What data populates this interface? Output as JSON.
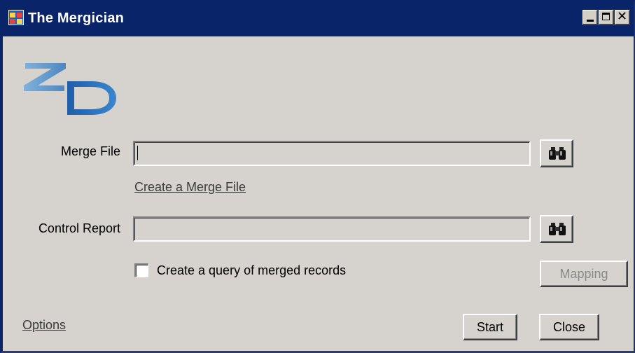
{
  "window": {
    "title": "The Mergician",
    "icon": "app-window-icon",
    "caption_buttons": [
      "minimize-icon",
      "maximize-icon",
      "close-icon"
    ]
  },
  "logo": {
    "icon": "zd-logo"
  },
  "merge_file": {
    "label": "Merge File",
    "value": "",
    "browse_icon": "binoculars-icon"
  },
  "create_merge_link": "Create a Merge File",
  "control_report": {
    "label": "Control Report",
    "value": "",
    "browse_icon": "binoculars-icon"
  },
  "query_checkbox": {
    "label": "Create a query of merged records",
    "checked": false
  },
  "buttons": {
    "mapping": "Mapping",
    "mapping_enabled": false,
    "start": "Start",
    "close": "Close"
  },
  "options_link": "Options",
  "colors": {
    "titlebar": "#0a246a",
    "face": "#d6d3ce",
    "logo_z": "#6a9ccc",
    "logo_d": "#2a6bb8"
  }
}
